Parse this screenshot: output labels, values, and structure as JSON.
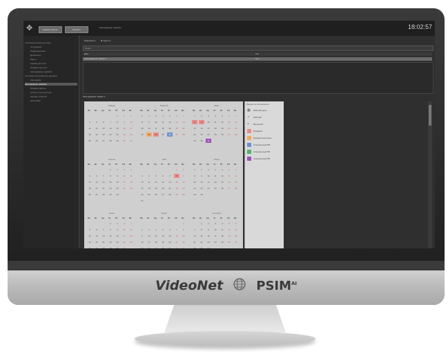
{
  "app": {
    "clock": "18:02:57",
    "top_buttons": [
      "Администратор",
      "Сменить"
    ],
    "breadcrumb": "Календарные графики"
  },
  "sidebar": {
    "items": [
      {
        "label": "Система контроля доступа",
        "selected": false
      },
      {
        "label": "Сотрудники",
        "selected": false
      },
      {
        "label": "Подразделения",
        "selected": false
      },
      {
        "label": "Должности",
        "selected": false
      },
      {
        "label": "Карты",
        "selected": false
      },
      {
        "label": "Уровни доступа",
        "selected": false
      },
      {
        "label": "Графики доступа",
        "selected": false
      },
      {
        "label": "Календарные графики",
        "selected": false
      },
      {
        "label": "Система учёта рабочего времени",
        "selected": false
      },
      {
        "label": "Календари",
        "selected": false
      },
      {
        "label": "Календарные графики",
        "selected": true
      },
      {
        "label": "Графики работы",
        "selected": false
      },
      {
        "label": "Группы точек доступа",
        "selected": false
      },
      {
        "label": "Журнал событий",
        "selected": false
      },
      {
        "label": "Настройки",
        "selected": false
      }
    ]
  },
  "toolbar": {
    "add_label": "Добавить",
    "delete_label": "Удалить"
  },
  "grid": {
    "filter": "Поиск",
    "columns": [
      "Имя",
      "Тип"
    ],
    "rows": [
      {
        "name": "Календарный график 1",
        "type": "Год"
      }
    ]
  },
  "calendar_title": "Календарный график 1",
  "calendar": {
    "day_headers": [
      "Пн",
      "Вт",
      "Ср",
      "Чт",
      "Пт",
      "Сб",
      "Вс"
    ],
    "months": [
      {
        "name": "Январь",
        "days": [
          null,
          null,
          null,
          null,
          1,
          2,
          3,
          4,
          5,
          6,
          7,
          8,
          9,
          10,
          11,
          12,
          13,
          14,
          15,
          16,
          17,
          18,
          19,
          20,
          21,
          22,
          23,
          24,
          25,
          26,
          27,
          28,
          29,
          30,
          31
        ]
      },
      {
        "name": "Февраль",
        "days": [
          1,
          2,
          3,
          4,
          5,
          6,
          7,
          8,
          9,
          10,
          11,
          12,
          13,
          14,
          15,
          16,
          17,
          18,
          19,
          20,
          21,
          22,
          23,
          24,
          25,
          26,
          27,
          28
        ]
      },
      {
        "name": "Март",
        "days": [
          1,
          2,
          3,
          4,
          5,
          6,
          7,
          8,
          9,
          10,
          11,
          12,
          13,
          14,
          15,
          16,
          17,
          18,
          19,
          20,
          21,
          22,
          23,
          24,
          25,
          26,
          27,
          28,
          29,
          30,
          31
        ]
      },
      {
        "name": "Апрель",
        "days": [
          null,
          null,
          null,
          1,
          2,
          3,
          4,
          5,
          6,
          7,
          8,
          9,
          10,
          11,
          12,
          13,
          14,
          15,
          16,
          17,
          18,
          19,
          20,
          21,
          22,
          23,
          24,
          25,
          26,
          27,
          28,
          29,
          30
        ]
      },
      {
        "name": "Май",
        "days": [
          null,
          null,
          null,
          null,
          null,
          1,
          2,
          3,
          4,
          5,
          6,
          7,
          8,
          9,
          10,
          11,
          12,
          13,
          14,
          15,
          16,
          17,
          18,
          19,
          20,
          21,
          22,
          23,
          24,
          25,
          26,
          27,
          28,
          29,
          30,
          31
        ]
      },
      {
        "name": "Июнь",
        "days": [
          1,
          2,
          3,
          4,
          5,
          6,
          7,
          8,
          9,
          10,
          11,
          12,
          13,
          14,
          15,
          16,
          17,
          18,
          19,
          20,
          21,
          22,
          23,
          24,
          25,
          26,
          27,
          28,
          29,
          30
        ]
      },
      {
        "name": "Июль",
        "days": [
          null,
          null,
          null,
          1,
          2,
          3,
          4,
          5,
          6,
          7,
          8,
          9,
          10,
          11,
          12,
          13,
          14,
          15,
          16,
          17,
          18,
          19,
          20,
          21,
          22,
          23,
          24,
          25,
          26,
          27,
          28,
          29,
          30,
          31
        ]
      },
      {
        "name": "Август",
        "days": [
          null,
          null,
          null,
          null,
          null,
          null,
          1,
          2,
          3,
          4,
          5,
          6,
          7,
          8,
          9,
          10,
          11,
          12,
          13,
          14,
          15,
          16,
          17,
          18,
          19,
          20,
          21,
          22,
          23,
          24,
          25,
          26,
          27,
          28,
          29,
          30,
          31
        ]
      },
      {
        "name": "Сентябрь",
        "days": [
          null,
          1,
          2,
          3,
          4,
          5,
          6,
          7,
          8,
          9,
          10,
          11,
          12,
          13,
          14,
          15,
          16,
          17,
          18,
          19,
          20,
          21,
          22,
          23,
          24,
          25,
          26,
          27,
          28,
          29,
          30
        ]
      },
      {
        "name": "Октябрь",
        "days": []
      },
      {
        "name": "Ноябрь",
        "days": []
      },
      {
        "name": "Декабрь",
        "days": []
      }
    ],
    "highlights": [
      {
        "month": 1,
        "day": 23,
        "color": "orange"
      },
      {
        "month": 1,
        "day": 24,
        "color": "red"
      },
      {
        "month": 1,
        "day": 26,
        "color": "blue"
      },
      {
        "month": 2,
        "day": 8,
        "color": "red"
      },
      {
        "month": 2,
        "day": 9,
        "color": "red"
      },
      {
        "month": 2,
        "day": 31,
        "color": "purple"
      },
      {
        "month": 4,
        "day": 8,
        "color": "red"
      }
    ]
  },
  "legend": {
    "title": "Варианты обозначения",
    "items": [
      {
        "label": "Рабочий день",
        "icon": "grid-icon",
        "color": ""
      },
      {
        "label": "Рабочий",
        "icon": "check-icon",
        "color": ""
      },
      {
        "label": "Выходной",
        "icon": "x-icon",
        "color": ""
      },
      {
        "label": "Праздник",
        "icon": "swatch",
        "color": "#e98b8b"
      },
      {
        "label": "Праздничный день",
        "icon": "swatch",
        "color": "#f0a860"
      },
      {
        "label": "Специальный РВ",
        "icon": "swatch",
        "color": "#6f8fd0"
      },
      {
        "label": "Специальный РВ",
        "icon": "swatch",
        "color": "#4fb36a"
      },
      {
        "label": "Специальный РВ",
        "icon": "swatch",
        "color": "#9a52b8"
      }
    ]
  },
  "brand": {
    "videonet": "VideoNet",
    "psim": "PSIM",
    "psim_sup": "AI"
  }
}
